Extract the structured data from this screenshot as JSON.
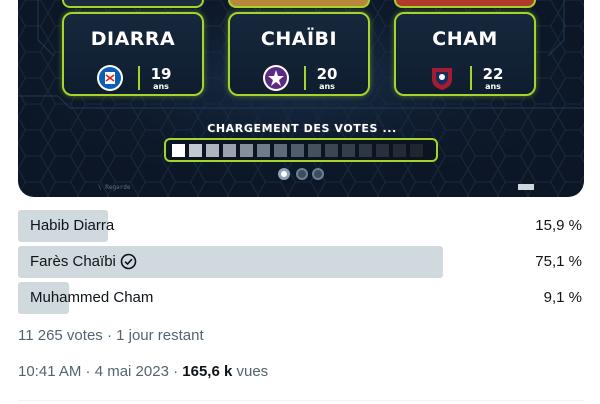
{
  "media": {
    "players": [
      {
        "name": "DIARRA",
        "age": "19",
        "age_unit": "ans",
        "club_icon": "strasbourg-crest-icon"
      },
      {
        "name": "CHAÏBI",
        "age": "20",
        "age_unit": "ans",
        "club_icon": "toulouse-crest-icon"
      },
      {
        "name": "CHAM",
        "age": "22",
        "age_unit": "ans",
        "club_icon": "clermont-crest-icon"
      }
    ],
    "loading_text": "CHARGEMENT DES VOTES ...",
    "progress_segments": 15,
    "progress_filled": 1,
    "watermark": "\\ Regarde",
    "accent": "#a5d42a",
    "bg": "#0c1626"
  },
  "poll": {
    "options": [
      {
        "label": "Habib Diarra",
        "percent": "15,9 %",
        "share": 0.159,
        "verified": false
      },
      {
        "label": "Farès Chaïbi",
        "percent": "75,1 %",
        "share": 0.751,
        "verified": true
      },
      {
        "label": "Muhammed Cham",
        "percent": "9,1 %",
        "share": 0.091,
        "verified": false
      }
    ],
    "summary": "11 265 votes · 1 jour restant"
  },
  "tweet_meta": {
    "datetime": "10:41 AM · 4 mai 2023 · ",
    "views_count": "165,6 k",
    "views_label": " vues"
  }
}
